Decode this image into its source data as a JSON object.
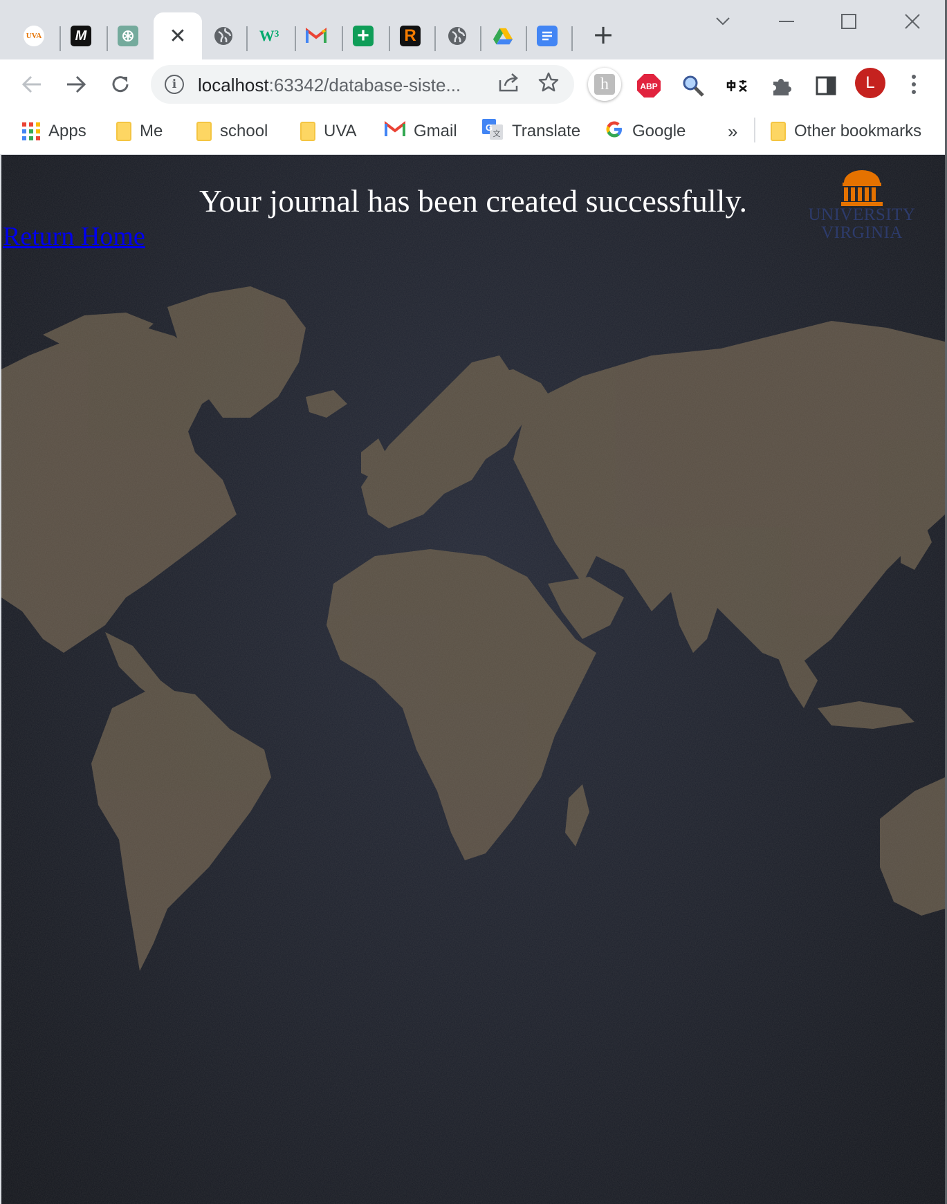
{
  "browser": {
    "tabs": [
      {
        "icon": "uva-favicon-icon",
        "text": "UVA"
      },
      {
        "icon": "mural-favicon-icon",
        "text": "M"
      },
      {
        "icon": "chatgpt-favicon-icon",
        "text": ""
      },
      {
        "icon": "close-tab-icon",
        "text": "✕",
        "active": true
      },
      {
        "icon": "globe-favicon-icon",
        "text": ""
      },
      {
        "icon": "w3schools-favicon-icon",
        "text": "W³"
      },
      {
        "icon": "gmail-favicon-icon",
        "text": "M"
      },
      {
        "icon": "sheets-plus-favicon-icon",
        "text": "+"
      },
      {
        "icon": "r-favicon-icon",
        "text": "R"
      },
      {
        "icon": "globe-favicon-icon",
        "text": ""
      },
      {
        "icon": "drive-favicon-icon",
        "text": ""
      },
      {
        "icon": "docs-favicon-icon",
        "text": ""
      }
    ],
    "new_tab_label": "+",
    "address": {
      "host": "localhost",
      "rest": ":63342/database-siste..."
    },
    "avatar_letter": "L",
    "bookmarks": {
      "apps": "Apps",
      "me": "Me",
      "school": "school",
      "uva": "UVA",
      "gmail": "Gmail",
      "translate": "Translate",
      "google": "Google",
      "overflow": "»",
      "other": "Other bookmarks"
    }
  },
  "page": {
    "headline": "Your journal has been created successfully.",
    "return_link": "Return Home",
    "logo": {
      "line1": "UNIVERSITY",
      "line2": "VIRGINIA"
    }
  },
  "colors": {
    "page_background": "#1b1f2a",
    "continents": "#5e5446",
    "logo_orange": "#e57200",
    "logo_navy": "#2d3b6b",
    "link_blue": "#0000ee"
  }
}
